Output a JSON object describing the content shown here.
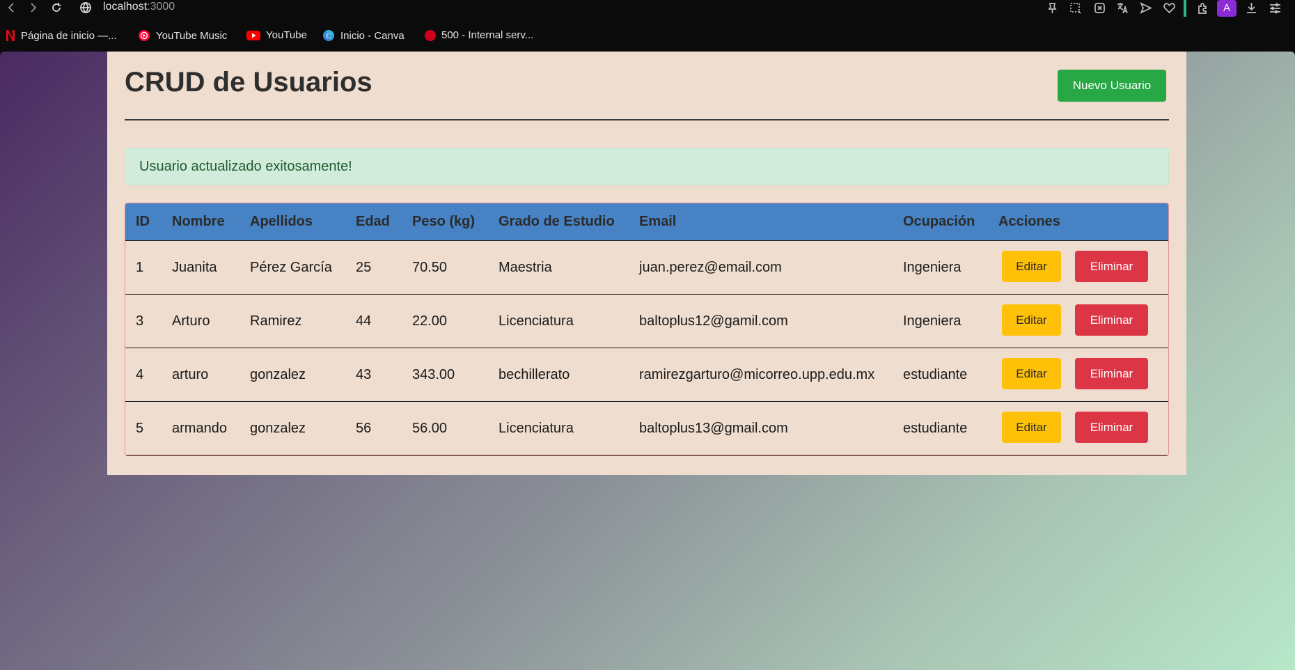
{
  "browser": {
    "url_host": "localhost",
    "url_port": ":3000",
    "avatar_letter": "A",
    "bookmarks": [
      {
        "label": "Página de inicio —...",
        "icon": "netflix-icon",
        "color": "#e50914"
      },
      {
        "label": "YouTube Music",
        "icon": "youtube-music-icon",
        "color": "#ff0033"
      },
      {
        "label": "YouTube",
        "icon": "youtube-icon",
        "color": "#ff0000"
      },
      {
        "label": "Inicio - Canva",
        "icon": "canva-icon",
        "color": "#3b6fe0"
      },
      {
        "label": "500 - Internal serv...",
        "icon": "error-site-icon",
        "color": "#d0021b"
      }
    ]
  },
  "header": {
    "title": "CRUD de Usuarios",
    "new_button": "Nuevo Usuario"
  },
  "alert": {
    "message": "Usuario actualizado exitosamente!"
  },
  "table": {
    "columns": [
      "ID",
      "Nombre",
      "Apellidos",
      "Edad",
      "Peso (kg)",
      "Grado de Estudio",
      "Email",
      "Ocupación",
      "Acciones"
    ],
    "rows": [
      {
        "id": "1",
        "nombre": "Juanita",
        "apellidos": "Pérez García",
        "edad": "25",
        "peso": "70.50",
        "grado": "Maestria",
        "email": "juan.perez@email.com",
        "ocupacion": "Ingeniera"
      },
      {
        "id": "3",
        "nombre": "Arturo",
        "apellidos": "Ramirez",
        "edad": "44",
        "peso": "22.00",
        "grado": "Licenciatura",
        "email": "baltoplus12@gamil.com",
        "ocupacion": "Ingeniera"
      },
      {
        "id": "4",
        "nombre": "arturo",
        "apellidos": "gonzalez",
        "edad": "43",
        "peso": "343.00",
        "grado": "bechillerato",
        "email": "ramirezgarturo@micorreo.upp.edu.mx",
        "ocupacion": "estudiante"
      },
      {
        "id": "5",
        "nombre": "armando",
        "apellidos": "gonzalez",
        "edad": "56",
        "peso": "56.00",
        "grado": "Licenciatura",
        "email": "baltoplus13@gmail.com",
        "ocupacion": "estudiante"
      }
    ],
    "edit_label": "Editar",
    "delete_label": "Eliminar"
  },
  "colors": {
    "primary_header": "#4682c4",
    "success": "#28a745",
    "warning": "#ffc107",
    "danger": "#dc3545",
    "container_bg": "#efddcf"
  }
}
